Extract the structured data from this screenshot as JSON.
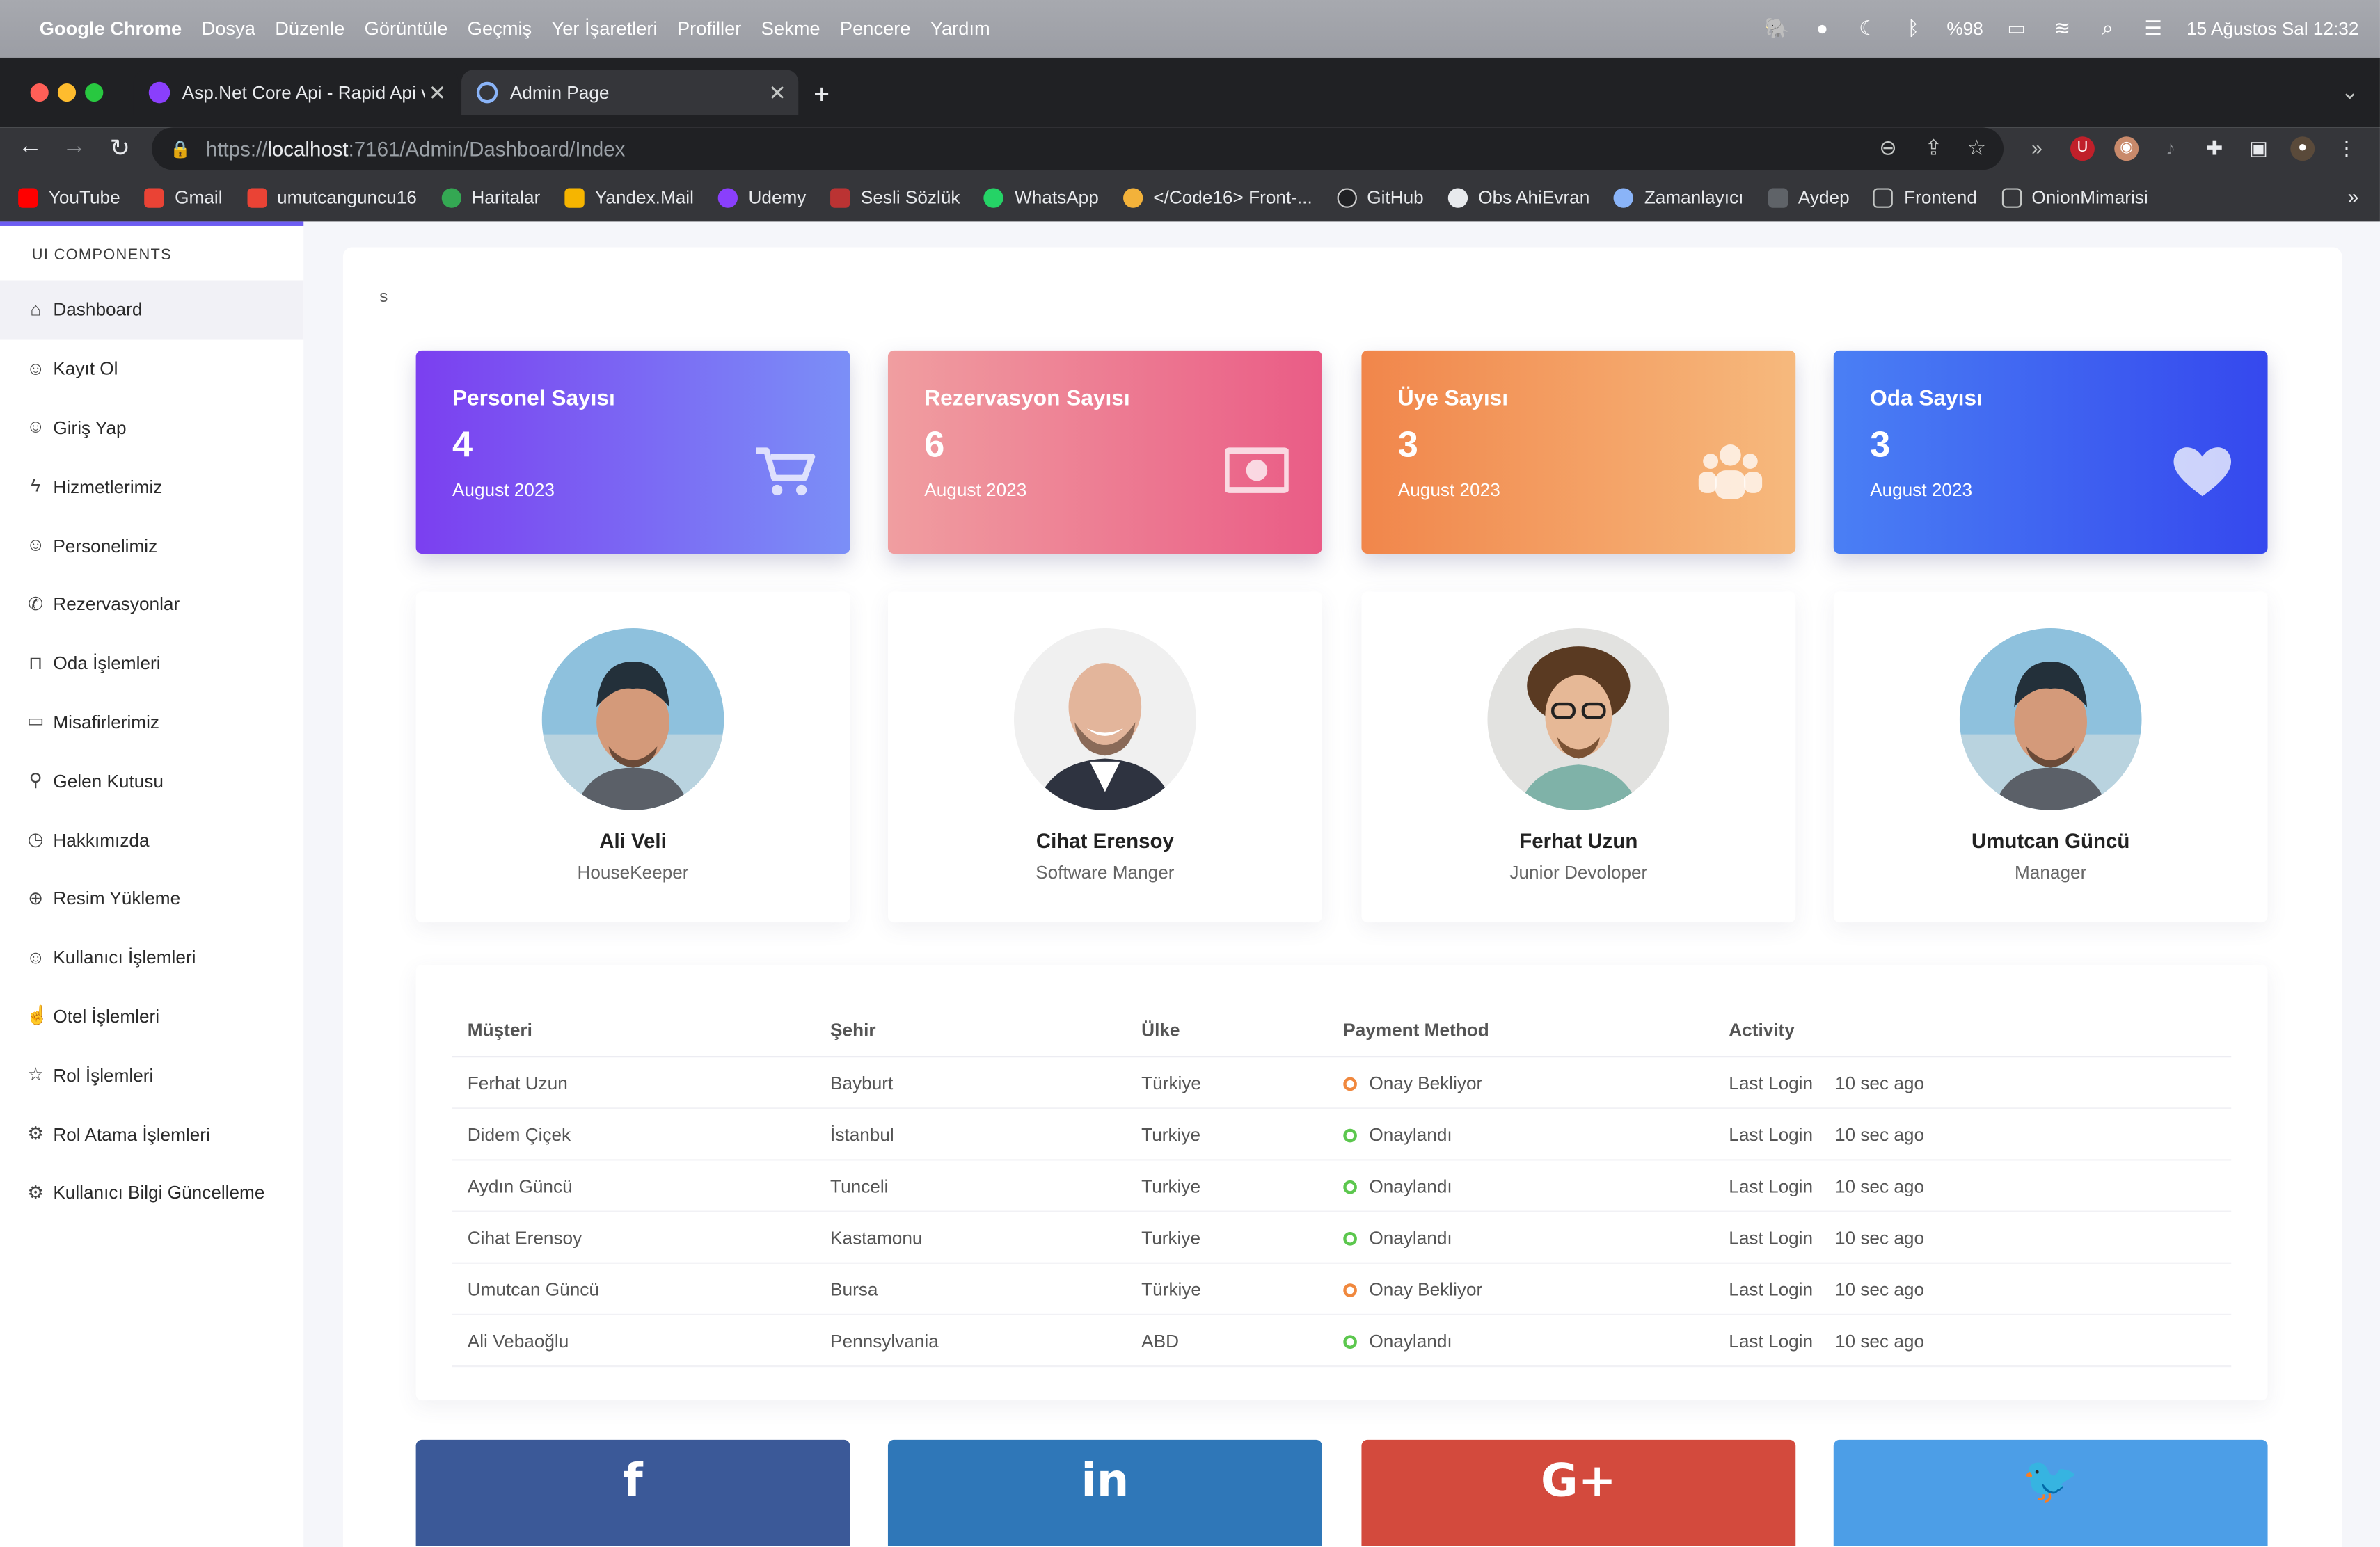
{
  "menubar": {
    "app": "Google Chrome",
    "menus": [
      "Dosya",
      "Düzenle",
      "Görüntüle",
      "Geçmiş",
      "Yer İşaretleri",
      "Profiller",
      "Sekme",
      "Pencere",
      "Yardım"
    ],
    "battery": "%98",
    "datetime": "15 Ağustos Sal  12:32"
  },
  "tabs": [
    {
      "title": "Asp.Net Core Api - Rapid Api v",
      "active": false
    },
    {
      "title": "Admin Page",
      "active": true
    }
  ],
  "url": {
    "scheme": "https://",
    "host": "localhost",
    "rest": ":7161/Admin/Dashboard/Index"
  },
  "bookmarks": [
    "YouTube",
    "Gmail",
    "umutcanguncu16",
    "Haritalar",
    "Yandex.Mail",
    "Udemy",
    "Sesli Sözlük",
    "WhatsApp",
    "</Code16> Front-...",
    "GitHub",
    "Obs AhiEvran",
    "Zamanlayıcı",
    "Aydep",
    "Frontend",
    "OnionMimarisi"
  ],
  "bookmark_more": "»",
  "sidebar": {
    "section": "UI COMPONENTS",
    "items": [
      {
        "label": "Dashboard",
        "icon": "home-icon"
      },
      {
        "label": "Kayıt Ol",
        "icon": "user-add-icon"
      },
      {
        "label": "Giriş Yap",
        "icon": "user-icon"
      },
      {
        "label": "Hizmetlerimiz",
        "icon": "bolt-icon"
      },
      {
        "label": "Personelimiz",
        "icon": "users-icon"
      },
      {
        "label": "Rezervasyonlar",
        "icon": "phone-icon"
      },
      {
        "label": "Oda İşlemleri",
        "icon": "bag-icon"
      },
      {
        "label": "Misafirlerimiz",
        "icon": "monitor-icon"
      },
      {
        "label": "Gelen Kutusu",
        "icon": "key-icon"
      },
      {
        "label": "Hakkımızda",
        "icon": "clock-icon"
      },
      {
        "label": "Resim Yükleme",
        "icon": "upload-icon"
      },
      {
        "label": "Kullanıcı İşlemleri",
        "icon": "user-icon"
      },
      {
        "label": "Otel İşlemleri",
        "icon": "thumbs-up-icon"
      },
      {
        "label": "Rol İşlemleri",
        "icon": "star-icon"
      },
      {
        "label": "Rol Atama İşlemleri",
        "icon": "gear-icon"
      },
      {
        "label": "Kullanıcı Bilgi Güncelleme",
        "icon": "gear-icon"
      }
    ]
  },
  "breadcrumb": "s",
  "stats": [
    {
      "title": "Personel Sayısı",
      "value": "4",
      "date": "August 2023",
      "icon": "cart-icon"
    },
    {
      "title": "Rezervasyon Sayısı",
      "value": "6",
      "date": "August 2023",
      "icon": "money-icon"
    },
    {
      "title": "Üye Sayısı",
      "value": "3",
      "date": "August 2023",
      "icon": "group-icon"
    },
    {
      "title": "Oda Sayısı",
      "value": "3",
      "date": "August 2023",
      "icon": "heart-icon"
    }
  ],
  "staff": [
    {
      "name": "Ali Veli",
      "role": "HouseKeeper"
    },
    {
      "name": "Cihat Erensoy",
      "role": "Software Manger"
    },
    {
      "name": "Ferhat Uzun",
      "role": "Junior Devoloper"
    },
    {
      "name": "Umutcan Güncü",
      "role": "Manager"
    }
  ],
  "table": {
    "headers": [
      "Müşteri",
      "Şehir",
      "Ülke",
      "Payment Method",
      "Activity"
    ],
    "rows": [
      {
        "customer": "Ferhat Uzun",
        "city": "Bayburt",
        "country": "Türkiye",
        "status": "Onay Bekliyor",
        "status_color": "#f0883e",
        "activity": "Last Login",
        "time": "10 sec ago"
      },
      {
        "customer": "Didem Çiçek",
        "city": "İstanbul",
        "country": "Turkiye",
        "status": "Onaylandı",
        "status_color": "#5cc74e",
        "activity": "Last Login",
        "time": "10 sec ago"
      },
      {
        "customer": "Aydın Güncü",
        "city": "Tunceli",
        "country": "Turkiye",
        "status": "Onaylandı",
        "status_color": "#5cc74e",
        "activity": "Last Login",
        "time": "10 sec ago"
      },
      {
        "customer": "Cihat Erensoy",
        "city": "Kastamonu",
        "country": "Turkiye",
        "status": "Onaylandı",
        "status_color": "#5cc74e",
        "activity": "Last Login",
        "time": "10 sec ago"
      },
      {
        "customer": "Umutcan Güncü",
        "city": "Bursa",
        "country": "Türkiye",
        "status": "Onay Bekliyor",
        "status_color": "#f0883e",
        "activity": "Last Login",
        "time": "10 sec ago"
      },
      {
        "customer": "Ali Vebaoğlu",
        "city": "Pennsylvania",
        "country": "ABD",
        "status": "Onaylandı",
        "status_color": "#5cc74e",
        "activity": "Last Login",
        "time": "10 sec ago"
      }
    ]
  },
  "social": [
    {
      "glyph": "f",
      "name": "facebook-icon"
    },
    {
      "glyph": "in",
      "name": "linkedin-icon"
    },
    {
      "glyph": "G+",
      "name": "google-plus-icon"
    },
    {
      "glyph": "🐦",
      "name": "twitter-icon"
    }
  ]
}
